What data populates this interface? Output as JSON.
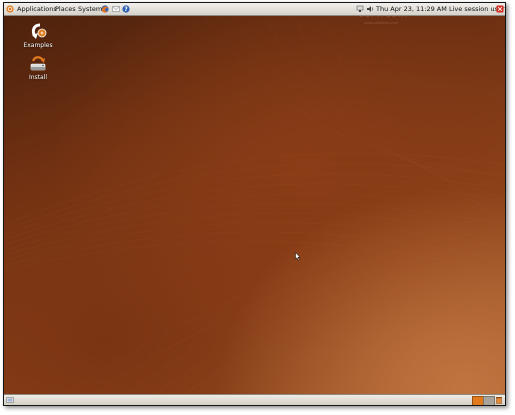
{
  "top_panel": {
    "menus": {
      "applications": "Applications",
      "places": "Places",
      "system": "System"
    },
    "clock": "Thu Apr 23, 11:29 AM",
    "session_user": "Live session user"
  },
  "desktop": {
    "icons": [
      {
        "label": "Examples"
      },
      {
        "label": "Install"
      }
    ]
  },
  "colors": {
    "panel": "#e6e3dc",
    "desktop_dark": "#4e220c",
    "desktop_light": "#c07540",
    "ubuntu_orange": "#e07a1c"
  }
}
